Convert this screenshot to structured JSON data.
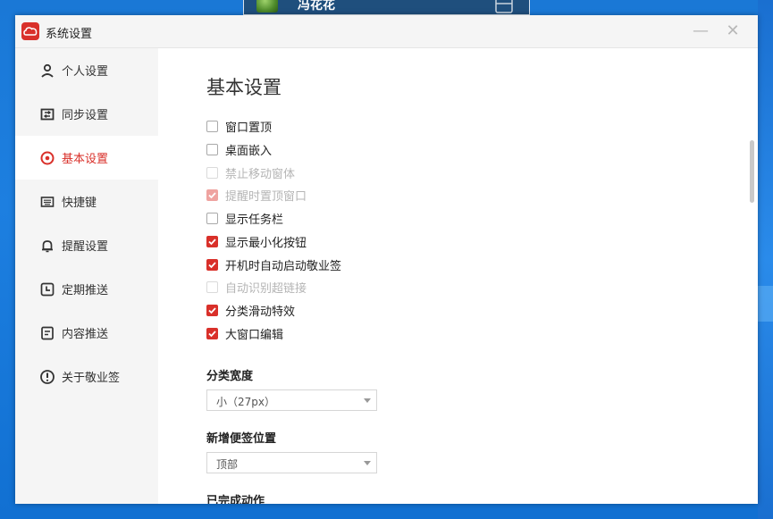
{
  "desktop": {
    "card_name": "冯花花"
  },
  "window": {
    "title": "系统设置",
    "minimize_symbol": "—",
    "close_symbol": "✕"
  },
  "sidebar": {
    "items": [
      {
        "label": "个人设置",
        "icon": "user-icon"
      },
      {
        "label": "同步设置",
        "icon": "sync-icon"
      },
      {
        "label": "基本设置",
        "icon": "target-icon",
        "active": true
      },
      {
        "label": "快捷键",
        "icon": "keyboard-icon"
      },
      {
        "label": "提醒设置",
        "icon": "bell-icon"
      },
      {
        "label": "定期推送",
        "icon": "clock-icon"
      },
      {
        "label": "内容推送",
        "icon": "document-icon"
      },
      {
        "label": "关于敬业签",
        "icon": "info-icon"
      }
    ]
  },
  "main": {
    "title": "基本设置",
    "options": [
      {
        "label": "窗口置顶",
        "checked": false,
        "disabled": false
      },
      {
        "label": "桌面嵌入",
        "checked": false,
        "disabled": false
      },
      {
        "label": "禁止移动窗体",
        "checked": false,
        "disabled": true
      },
      {
        "label": "提醒时置顶窗口",
        "checked": true,
        "disabled": true
      },
      {
        "label": "显示任务栏",
        "checked": false,
        "disabled": false
      },
      {
        "label": "显示最小化按钮",
        "checked": true,
        "disabled": false
      },
      {
        "label": "开机时自动启动敬业签",
        "checked": true,
        "disabled": false
      },
      {
        "label": "自动识别超链接",
        "checked": false,
        "disabled": true
      },
      {
        "label": "分类滑动特效",
        "checked": true,
        "disabled": false
      },
      {
        "label": "大窗口编辑",
        "checked": true,
        "disabled": false
      }
    ],
    "category_width": {
      "label": "分类宽度",
      "value": "小（27px）"
    },
    "new_note_position": {
      "label": "新增便签位置",
      "value": "顶部"
    },
    "completed_action": {
      "label": "已完成动作"
    }
  },
  "colors": {
    "accent": "#d9302a",
    "sidebar_bg": "#f5f5f5",
    "desktop_bg": "#1a78d6"
  }
}
